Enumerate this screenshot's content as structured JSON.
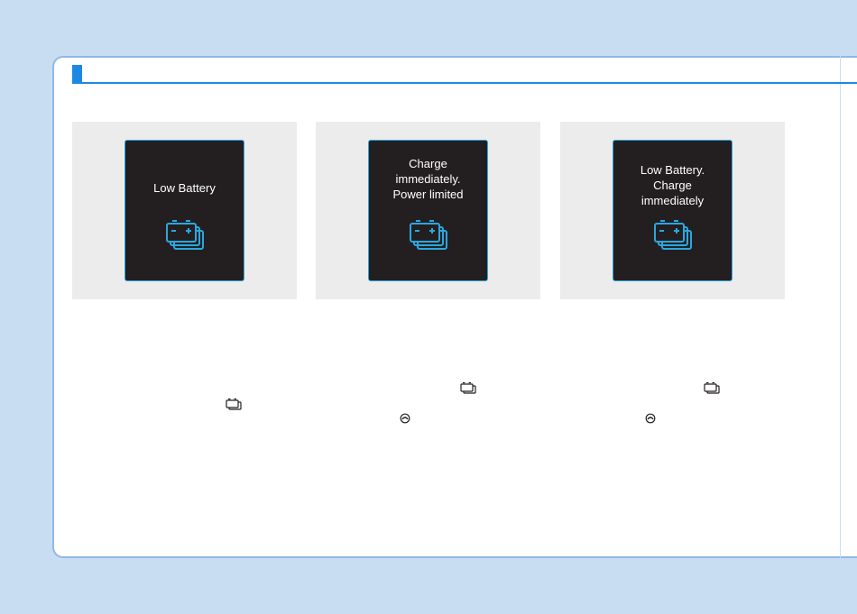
{
  "panels": [
    {
      "message": "Low Battery",
      "icon": "battery-icon"
    },
    {
      "message": "Charge\nimmediately.\nPower limited",
      "icon": "battery-icon"
    },
    {
      "message": "Low Battery.\nCharge\nimmediately",
      "icon": "battery-icon"
    }
  ],
  "colors": {
    "page_background": "#c9ddf2",
    "accent": "#1e88e5",
    "screen_background": "#231f20",
    "icon": "#29a8e0"
  },
  "inline_icons": [
    "battery-icon",
    "power-limited-icon"
  ]
}
